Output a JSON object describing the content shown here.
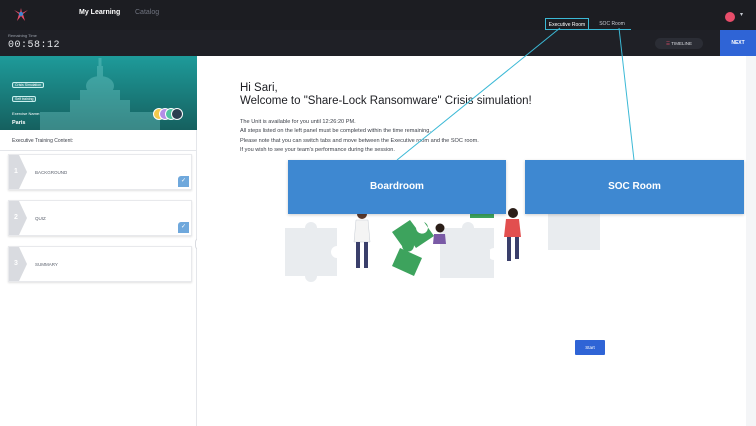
{
  "topbar": {
    "nav": [
      "My Learning",
      "Catalog"
    ],
    "tabs": [
      "Executive Room",
      "SOC Room"
    ]
  },
  "subbar": {
    "remaining_label": "Remaining Time",
    "remaining_time": "00:58:12",
    "timeline_label": "TIMELINE",
    "next_label": "NEXT"
  },
  "sidebar": {
    "hero_pills": [
      "Crisis Simulation",
      "Self training"
    ],
    "exercise_label": "Exercise Name:",
    "exercise_city": "Paris",
    "content_title": "Executive Training Content:",
    "steps": [
      {
        "num": "1",
        "label": "BACKGROUND",
        "completed": true
      },
      {
        "num": "2",
        "label": "QUIZ",
        "completed": true
      },
      {
        "num": "3",
        "label": "SUMMARY",
        "completed": false
      }
    ]
  },
  "main": {
    "greeting": "Hi Sari,",
    "welcome": "Welcome to \"Share-Lock Ransomware\" Crisis simulation!",
    "lines": [
      "The Unit is available for you until 12:26:20 PM.",
      "All steps listed on the left panel must be completed within the time remaining.",
      "Please note that you can switch tabs and move between the Executive room and the SOC room.",
      "If you wish to see your team's performance during the session."
    ],
    "start_label": "Start"
  },
  "callouts": {
    "boardroom": "Boardroom",
    "soc_room": "SOC Room"
  },
  "colors": {
    "accent_blue": "#2f64d6",
    "callout_blue": "#3e88d1",
    "teal": "#1e9b9a",
    "pointer": "#3bb9d6",
    "puzzle_green": "#3da35d"
  }
}
